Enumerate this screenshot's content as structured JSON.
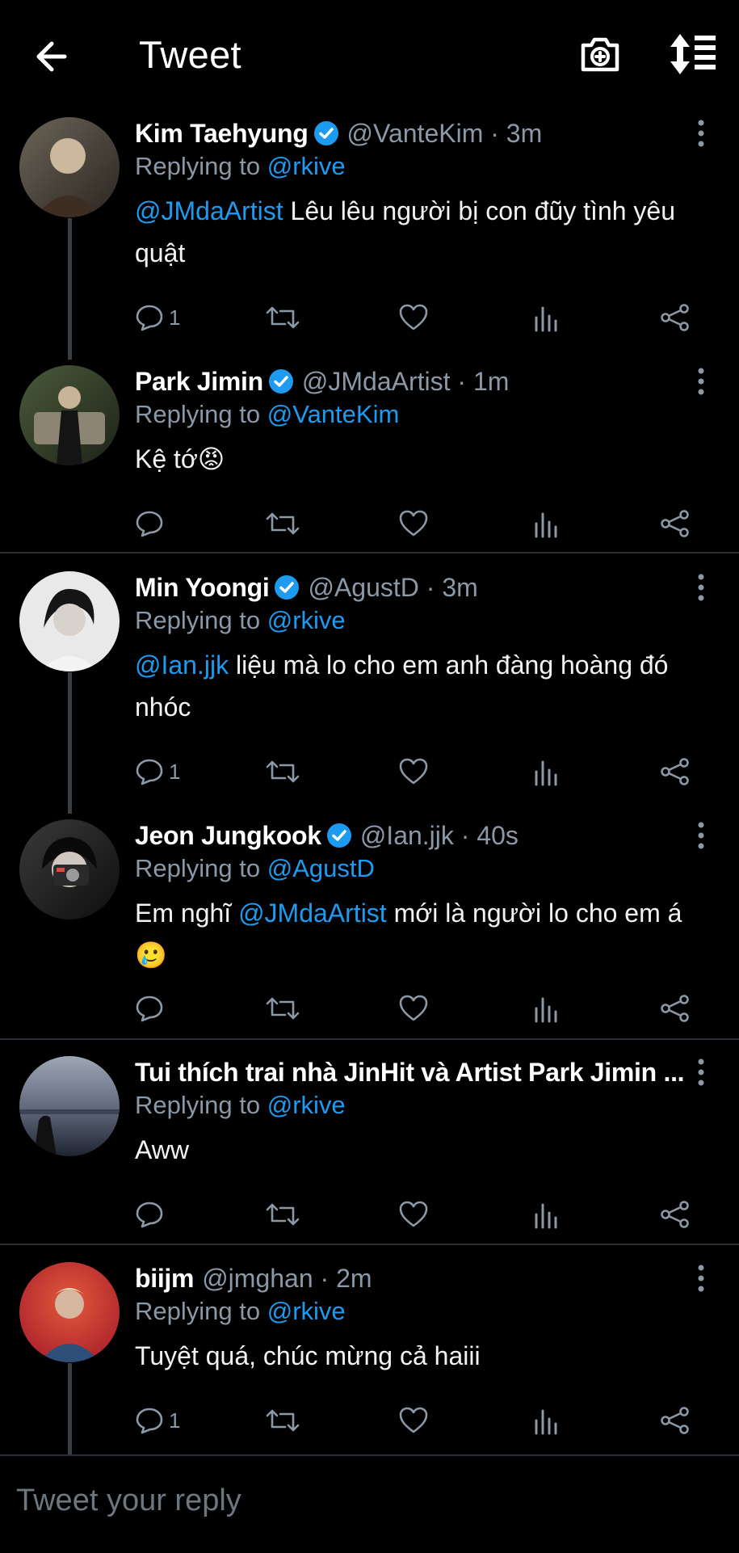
{
  "header": {
    "title": "Tweet",
    "back_icon": "back-arrow-icon",
    "camera_icon": "camera-icon",
    "sort_icon": "sort-icon"
  },
  "colors": {
    "accent": "#1d9bf0",
    "muted": "#8b98a5",
    "background": "#000000"
  },
  "tweets": [
    {
      "name": "Kim Taehyung",
      "verified": true,
      "handle": "@VanteKim",
      "time": "3m",
      "replying_label": "Replying to",
      "replying_to": "@rkive",
      "mention": "@JMdaArtist",
      "text": " Lêu lêu người bị con đũy tình yêu quật",
      "reply_count": "1"
    },
    {
      "name": "Park Jimin",
      "verified": true,
      "handle": "@JMdaArtist",
      "time": "1m",
      "replying_label": "Replying to",
      "replying_to": "@VanteKim",
      "text": "Kệ tớ",
      "emoji": "😡",
      "reply_count": ""
    },
    {
      "name": "Min Yoongi",
      "verified": true,
      "handle": "@AgustD",
      "time": "3m",
      "replying_label": "Replying to",
      "replying_to": "@rkive",
      "mention": "@Ian.jjk",
      "text": " liệu mà lo cho em anh đàng hoàng đó nhóc",
      "reply_count": "1"
    },
    {
      "name": "Jeon Jungkook",
      "verified": true,
      "handle": "@Ian.jjk",
      "time": "40s",
      "replying_label": "Replying to",
      "replying_to": "@AgustD",
      "text_before": "Em nghĩ ",
      "mention": "@JMdaArtist",
      "text_after": " mới là người lo cho em á",
      "emoji": "🥲",
      "reply_count": ""
    },
    {
      "name": "Tui thích trai nhà JinHit và Artist Park Jimin ...",
      "verified": false,
      "replying_label": "Replying to",
      "replying_to": "@rkive",
      "text": "Aww",
      "reply_count": ""
    },
    {
      "name": "biijm",
      "verified": false,
      "handle": "@jmghan",
      "time": "2m",
      "replying_label": "Replying to",
      "replying_to": "@rkive",
      "text": "Tuyệt quá, chúc mừng cả haiii",
      "reply_count": "1"
    }
  ],
  "reply_box": {
    "placeholder": "Tweet your reply"
  }
}
